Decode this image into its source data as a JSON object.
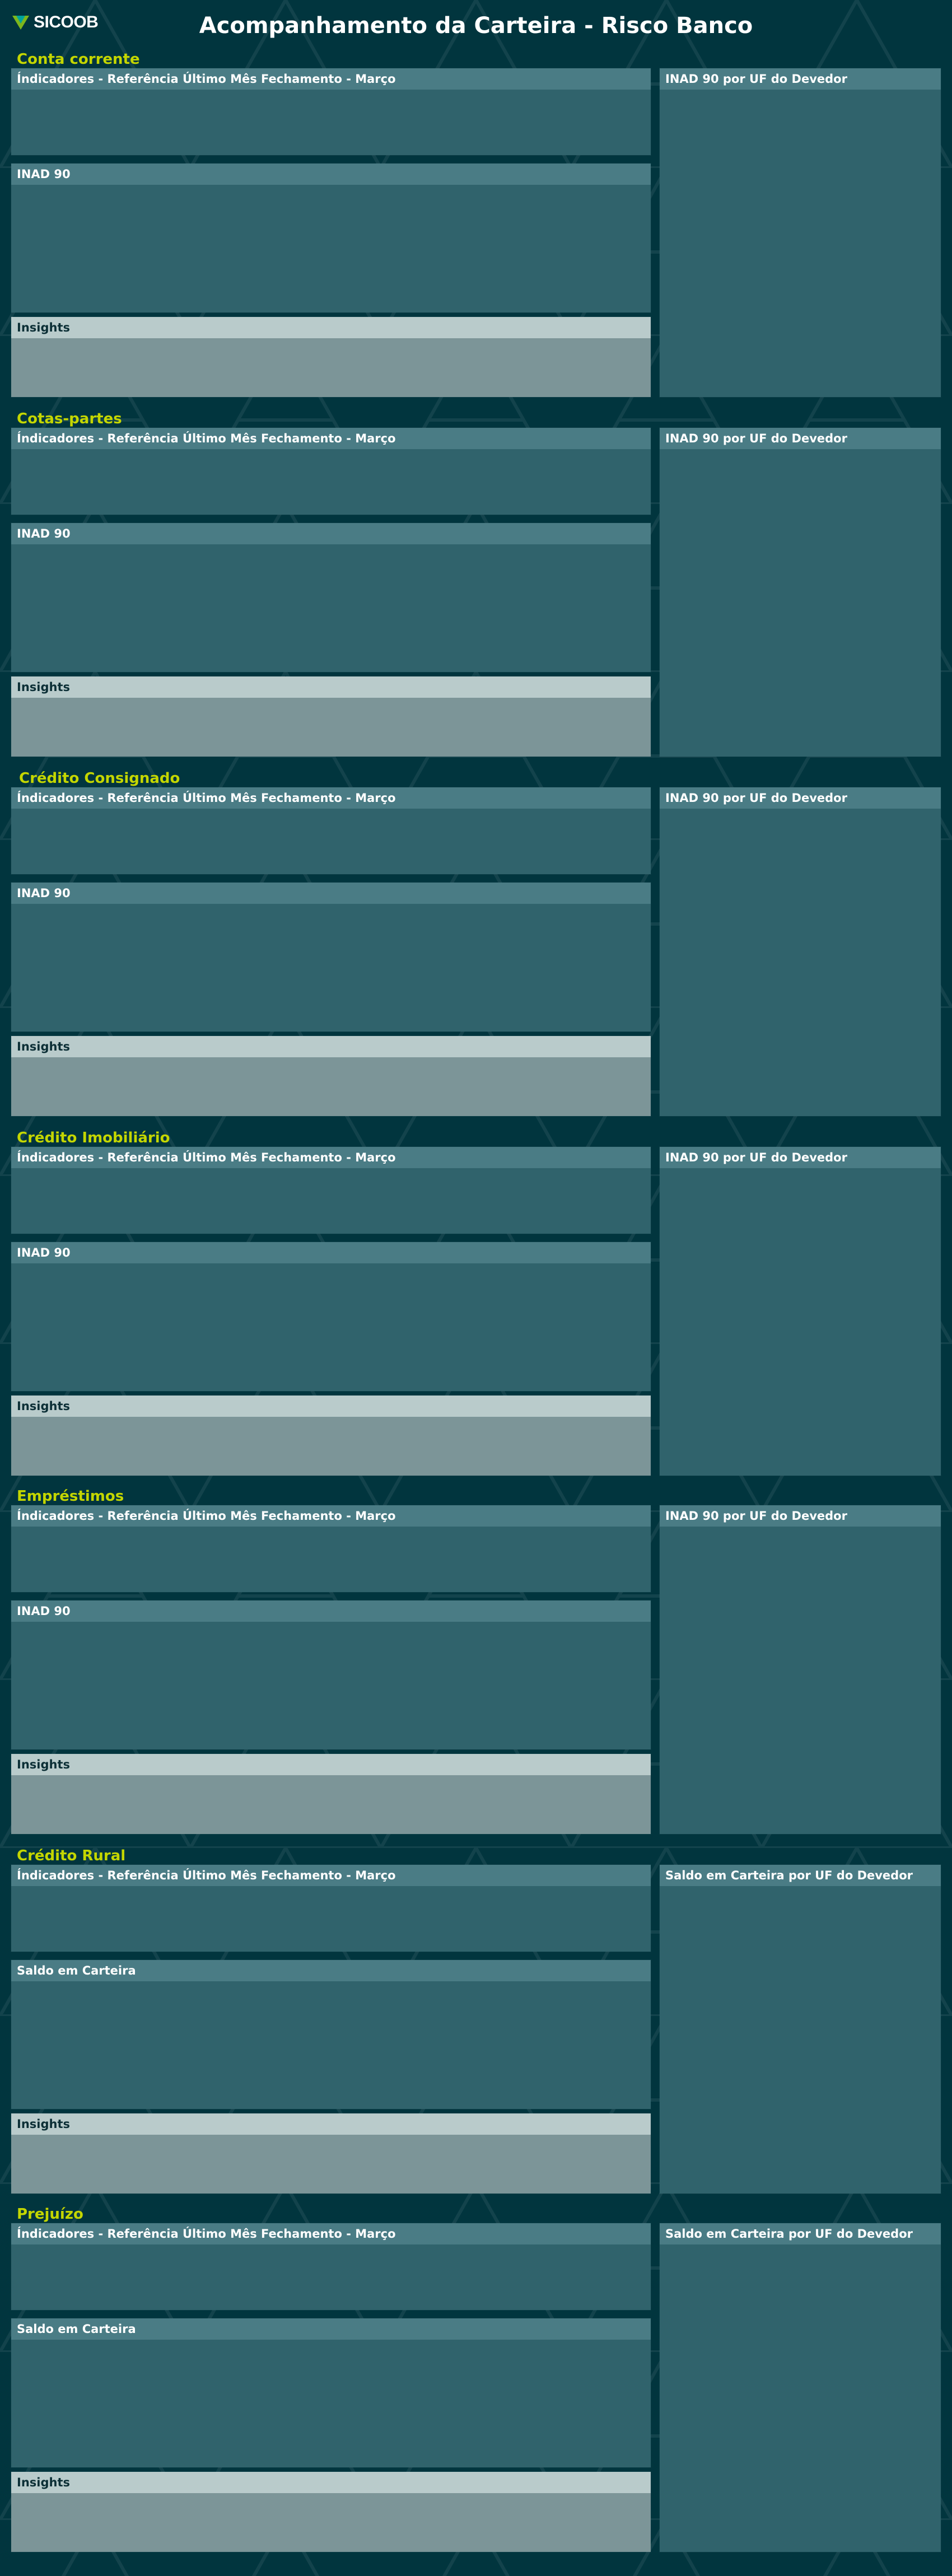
{
  "header": {
    "logo_text": "SICOOB",
    "title": "Acompanhamento da Carteira - Risco Banco"
  },
  "sections": [
    {
      "title": "Conta corrente",
      "indicators_title": "Índicadores - Referência Último Mês Fechamento - Março",
      "middle_title": "INAD 90",
      "insights_title": "Insights",
      "uf_title": "INAD 90 por UF do Devedor"
    },
    {
      "title": "Cotas-partes",
      "indicators_title": "Índicadores - Referência Último Mês Fechamento - Março",
      "middle_title": "INAD 90",
      "insights_title": "Insights",
      "uf_title": "INAD 90 por UF do Devedor"
    },
    {
      "title": "Crédito Consignado",
      "indicators_title": "Índicadores - Referência Último Mês Fechamento - Março",
      "middle_title": "INAD 90",
      "insights_title": "Insights",
      "uf_title": "INAD 90 por UF do Devedor"
    },
    {
      "title": "Crédito Imobiliário",
      "indicators_title": "Índicadores - Referência Último Mês Fechamento - Março",
      "middle_title": "INAD 90",
      "insights_title": "Insights",
      "uf_title": "INAD 90 por UF do Devedor"
    },
    {
      "title": "Empréstimos",
      "indicators_title": "Índicadores - Referência Último Mês Fechamento - Março",
      "middle_title": "INAD 90",
      "insights_title": "Insights",
      "uf_title": "INAD 90 por UF do Devedor"
    },
    {
      "title": "Crédito Rural",
      "indicators_title": "Índicadores - Referência Último Mês Fechamento - Março",
      "middle_title": "Saldo em Carteira",
      "insights_title": "Insights",
      "uf_title": "Saldo em Carteira por UF do Devedor"
    },
    {
      "title": "Prejuízo",
      "indicators_title": "Índicadores - Referência Último Mês Fechamento - Março",
      "middle_title": "Saldo em Carteira",
      "insights_title": "Insights",
      "uf_title": "Saldo em Carteira por UF do Devedor"
    }
  ],
  "colors": {
    "background": "#01353e",
    "section_title": "#c4d600",
    "panel": "#30636c",
    "panel_header": "#4a7c85",
    "insights_panel": "#7c9598",
    "insights_header": "#b9cbcb",
    "logo_green": "#7db61c"
  },
  "icons": {
    "logo": "sicoob-logo-icon"
  }
}
